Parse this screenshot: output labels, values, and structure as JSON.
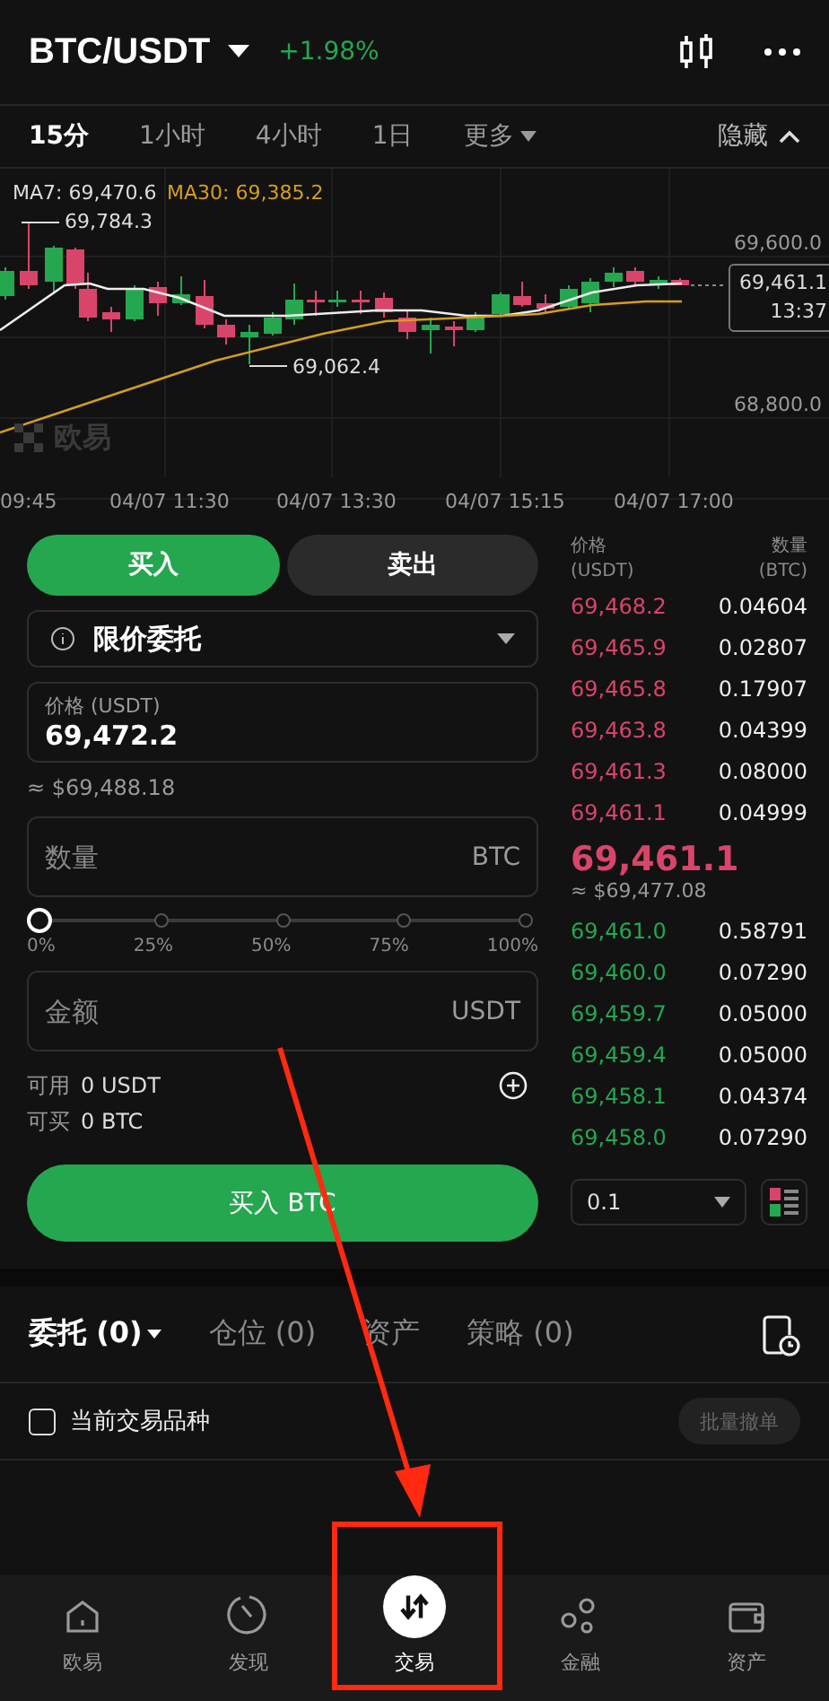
{
  "header": {
    "pair": "BTC/USDT",
    "change": "+1.98%"
  },
  "intervals": [
    {
      "label": "15分",
      "selected": true,
      "kind": "tab"
    },
    {
      "label": "1小时",
      "selected": false,
      "kind": "tab"
    },
    {
      "label": "4小时",
      "selected": false,
      "kind": "tab"
    },
    {
      "label": "1日",
      "selected": false,
      "kind": "tab"
    },
    {
      "label": "更多",
      "selected": false,
      "kind": "dropdown"
    }
  ],
  "hide_button": "隐藏",
  "chart": {
    "ma7": "MA7: 69,470.6",
    "ma30": "MA30: 69,385.2",
    "high_marker": "69,784.3",
    "low_marker": "69,062.4",
    "price_axis": [
      "69,600.0",
      "68,800.0"
    ],
    "time_axis": [
      "09:45",
      "04/07 11:30",
      "04/07 13:30",
      "04/07 15:15",
      "04/07 17:00"
    ],
    "last_price": "69,461.1",
    "countdown": "13:37",
    "watermark": "欧易"
  },
  "trade_form": {
    "sides": [
      {
        "label": "买入",
        "selected": true
      },
      {
        "label": "卖出",
        "selected": false
      }
    ],
    "order_type": "限价委托",
    "price": {
      "label": "价格 (USDT)",
      "value": "69,472.2"
    },
    "price_usd": "≈ $69,488.18",
    "amount": {
      "placeholder": "数量",
      "unit": "BTC"
    },
    "slider": {
      "level": 0,
      "ticks": [
        "0%",
        "25%",
        "50%",
        "75%",
        "100%"
      ]
    },
    "total": {
      "placeholder": "金额",
      "unit": "USDT"
    },
    "balances": [
      {
        "label": "可用",
        "value": "0 USDT"
      },
      {
        "label": "可买",
        "value": "0 BTC"
      }
    ],
    "submit": "买入 BTC"
  },
  "order_book": {
    "price_header": "价格",
    "price_unit": "(USDT)",
    "qty_header": "数量",
    "qty_unit": "(BTC)",
    "asks": [
      {
        "price": "69,468.2",
        "qty": "0.04604"
      },
      {
        "price": "69,465.9",
        "qty": "0.02807"
      },
      {
        "price": "69,465.8",
        "qty": "0.17907"
      },
      {
        "price": "69,463.8",
        "qty": "0.04399"
      },
      {
        "price": "69,461.3",
        "qty": "0.08000"
      },
      {
        "price": "69,461.1",
        "qty": "0.04999"
      }
    ],
    "last_price": "69,461.1",
    "last_price_usd": "≈ $69,477.08",
    "bids": [
      {
        "price": "69,461.0",
        "qty": "0.58791"
      },
      {
        "price": "69,460.0",
        "qty": "0.07290"
      },
      {
        "price": "69,459.7",
        "qty": "0.05000"
      },
      {
        "price": "69,459.4",
        "qty": "0.05000"
      },
      {
        "price": "69,458.1",
        "qty": "0.04374"
      },
      {
        "price": "69,458.0",
        "qty": "0.07290"
      }
    ],
    "depth": "0.1"
  },
  "orders_tabs": [
    {
      "label": "委托 (0)",
      "selected": true,
      "kind": "dropdown"
    },
    {
      "label": "仓位 (0)",
      "selected": false,
      "kind": "tab"
    },
    {
      "label": "资产",
      "selected": false,
      "kind": "tab"
    },
    {
      "label": "策略 (0)",
      "selected": false,
      "kind": "tab"
    }
  ],
  "filter": {
    "label": "当前交易品种",
    "checked": false
  },
  "cancel_all": {
    "label": "批量撤单",
    "disabled": true
  },
  "bottom_nav": [
    {
      "label": "欧易",
      "selected": false,
      "kind": "home"
    },
    {
      "label": "发现",
      "selected": false,
      "kind": "discover"
    },
    {
      "label": "交易",
      "selected": true,
      "kind": "trade"
    },
    {
      "label": "金融",
      "selected": false,
      "kind": "finance"
    },
    {
      "label": "资产",
      "selected": false,
      "kind": "assets"
    }
  ]
}
